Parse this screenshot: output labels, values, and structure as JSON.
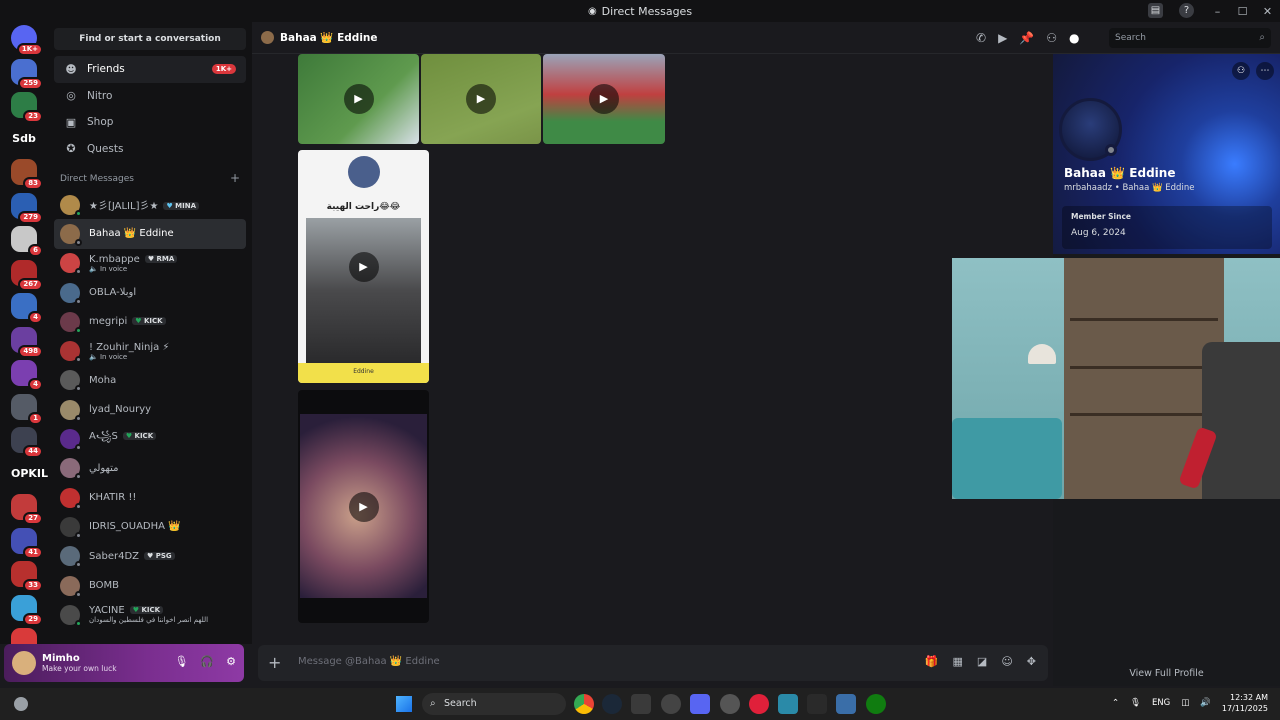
{
  "window": {
    "title": "Direct Messages",
    "controls": [
      "–",
      "☐",
      "✕"
    ]
  },
  "rail": {
    "servers": [
      {
        "badge": "1K+",
        "color": "#5865f2"
      },
      {
        "badge": "259",
        "color": "#4a6fd0"
      },
      {
        "badge": "23",
        "color": "#2d7d46"
      },
      {
        "text": "Sdb"
      },
      {
        "badge": "83",
        "color": "#9a4a2a"
      },
      {
        "badge": "279",
        "color": "#2b5fb3"
      },
      {
        "badge": "6",
        "color": "#c8c8c8"
      },
      {
        "badge": "267",
        "color": "#b02a2a"
      },
      {
        "badge": "4",
        "color": "#3a6fc4"
      },
      {
        "badge": "498",
        "color": "#6b3fa0"
      },
      {
        "badge": "4",
        "color": "#7b3fb0"
      },
      {
        "badge": "1",
        "color": "#555b66"
      },
      {
        "badge": "44",
        "color": "#3d4150"
      },
      {
        "text": "OPKIL"
      },
      {
        "badge": "27",
        "color": "#c23b3b"
      },
      {
        "badge": "41",
        "color": "#4450b5"
      },
      {
        "badge": "33",
        "color": "#b8302e"
      },
      {
        "badge": "29",
        "color": "#3aa0d8"
      },
      {
        "badge": "",
        "color": "#d93a3a"
      }
    ],
    "new_label": "NEW"
  },
  "sidebar": {
    "search_label": "Find or start a conversation",
    "nav": [
      {
        "label": "Friends",
        "icon": "friends-icon",
        "glyph": "☻",
        "badge": "1K+"
      },
      {
        "label": "Nitro",
        "icon": "nitro-icon",
        "glyph": "◎",
        "badge": ""
      },
      {
        "label": "Shop",
        "icon": "shop-icon",
        "glyph": "▣",
        "badge": ""
      },
      {
        "label": "Quests",
        "icon": "quests-icon",
        "glyph": "✪",
        "badge": ""
      }
    ],
    "dm_header": "Direct Messages",
    "dms": [
      {
        "name": "★彡[JALIL]彡★",
        "tag": "MINA",
        "tag_heart": "hb",
        "sub": "",
        "online": true,
        "color": "#b08a4a"
      },
      {
        "name": "Bahaa 👑 Eddine",
        "tag": "",
        "sub": "",
        "online": false,
        "color": "#8c6b4a",
        "active": true
      },
      {
        "name": "K.mbappe",
        "tag": "RMA",
        "tag_heart": "w",
        "sub": "In voice",
        "online": false,
        "color": "#c44"
      },
      {
        "name": "OBLA-اوبلا",
        "tag": "",
        "sub": "",
        "online": false,
        "color": "#4a6a8c"
      },
      {
        "name": "megripi",
        "tag": "KICK",
        "tag_heart": "h",
        "sub": "",
        "online": true,
        "color": "#6b3a4a"
      },
      {
        "name": "! Zouhir_Ninja ⚡",
        "tag": "",
        "sub": "In voice",
        "online": false,
        "color": "#a33"
      },
      {
        "name": "Moha",
        "tag": "",
        "sub": "",
        "online": false,
        "color": "#5a5a5a"
      },
      {
        "name": "lyad_Nouryy",
        "tag": "",
        "sub": "",
        "online": false,
        "color": "#9a8a6a"
      },
      {
        "name": "A꧁S",
        "tag": "KICK",
        "tag_heart": "h",
        "sub": "",
        "online": false,
        "color": "#5a2a8c"
      },
      {
        "name": "متهولي",
        "tag": "",
        "sub": "",
        "online": false,
        "color": "#8a6a7a"
      },
      {
        "name": "KHATIR !!",
        "tag": "",
        "sub": "",
        "online": false,
        "color": "#c03030"
      },
      {
        "name": "IDRIS_OUADHA 👑",
        "tag": "",
        "sub": "",
        "online": false,
        "color": "#3a3a3a"
      },
      {
        "name": "Saber4DZ",
        "tag": "PSG",
        "tag_heart": "w",
        "sub": "",
        "online": false,
        "color": "#5a6a7a"
      },
      {
        "name": "BOMB",
        "tag": "",
        "sub": "",
        "online": false,
        "color": "#8a6a5a"
      },
      {
        "name": "YACINE",
        "tag": "KICK",
        "tag_heart": "h",
        "sub": "اللهم انصر اخواننا في فلسطين والسودان",
        "online": true,
        "color": "#4a4a4a"
      }
    ]
  },
  "user_panel": {
    "name": "Mimho",
    "status": "Make your own luck"
  },
  "chat": {
    "recipient": "Bahaa 👑 Eddine",
    "search_placeholder": "Search",
    "composer_placeholder": "Message @Bahaa 👑 Eddine"
  },
  "media_card": {
    "caption": "راحت الهيبة😂😂",
    "brand": "Eddine"
  },
  "profile": {
    "display_name": "Bahaa 👑 Eddine",
    "username": "mrbahaadz • Bahaa 👑 Eddine",
    "member_since_label": "Member Since",
    "member_since": "Aug 6, 2024",
    "view_full": "View Full Profile"
  },
  "taskbar": {
    "search": "Search",
    "lang": "ENG",
    "time": "12:32 AM",
    "date": "17/11/2025"
  }
}
